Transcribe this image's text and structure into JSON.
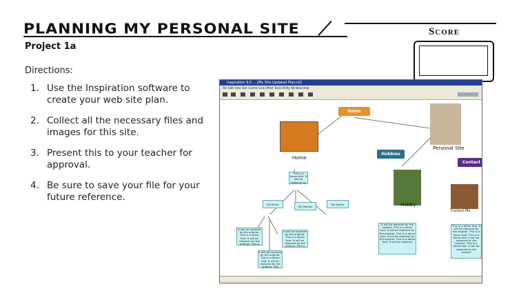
{
  "header": {
    "title": "PLANNING MY PERSONAL SITE",
    "score_label": "Score"
  },
  "project": "Project 1a",
  "directions_label": "Directions:",
  "steps": [
    {
      "num": "1.",
      "text": "Use the Inspiration software to create your web site plan."
    },
    {
      "num": "2.",
      "text": "Collect all the necessary files and images for this site."
    },
    {
      "num": "3.",
      "text": "Present this to your teacher for approval."
    },
    {
      "num": "4.",
      "text": "Be sure to save your file for your future reference."
    }
  ],
  "inspiration": {
    "window_title": "Inspiration 9.0 ... [My Site Updated Plan.isf]",
    "menu": "File  Edit  View  Text  Control  Link  Effect  Tools  Utility  Window  Help",
    "nodes": {
      "home_topic": "Home",
      "hobbies_topic": "Hobbies",
      "contact_topic": "Contact",
      "personal_site": "Personal Site",
      "home_label": "Home",
      "hobby_label": "Hobby",
      "contact_label": "Contact Me",
      "demo_home": "This is a demo text. It will be replaced by",
      "my_music": "My Music",
      "my_movies": "My Movies",
      "my_sports": "My Sports",
      "rep1": "It will be replaced by the original. This is a demo text. It will be replaced by the original. This is",
      "rep2": "It will be replaced by the original. This is a demo text. It will be replaced by the original. This is",
      "rep3": "It will be replaced by the original. This is a demo text. It will be replaced by the original. This",
      "hobby_text": "It will be replaced by the original. This is a demo text. It will be replaced by the original. This is a demo text. It will be replaced by the original. This is a demo text. It will be replaced",
      "contact_text": "This is a demo text. It will be replaced by the original. This is a demo text. This is a demo text. It will be replaced by the original. This is a demo text. It will be replaced by the original"
    }
  }
}
